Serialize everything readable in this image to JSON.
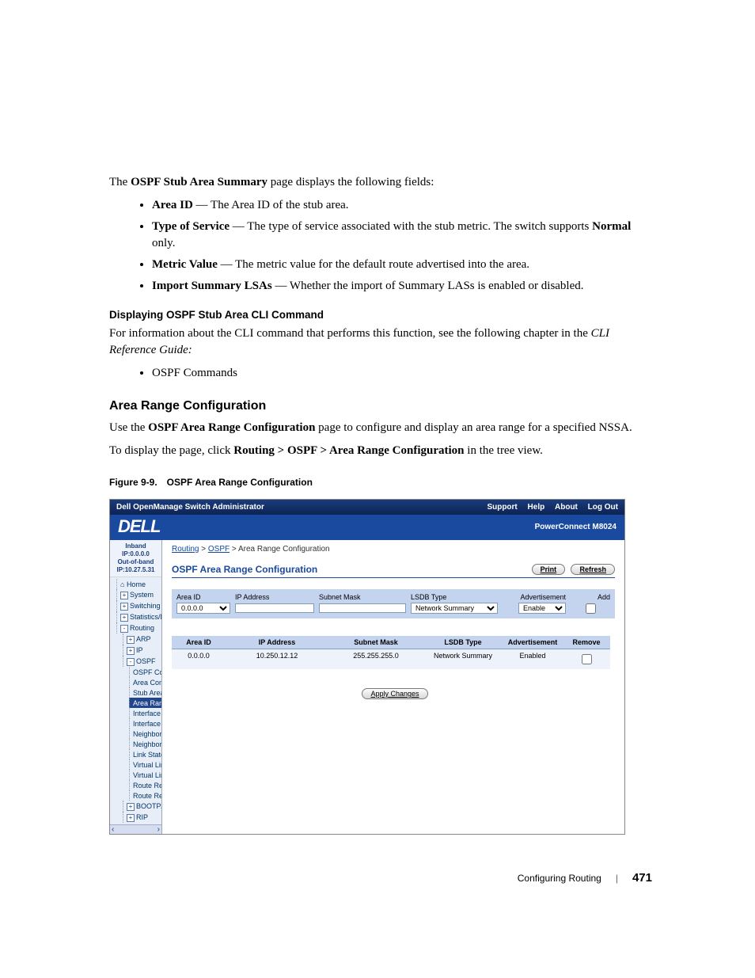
{
  "intro": {
    "lead_pre": "The ",
    "lead_bold": "OSPF Stub Area Summary",
    "lead_post": " page displays the following fields:"
  },
  "fields": [
    {
      "term": "Area ID",
      "desc": "The Area ID of the stub area."
    },
    {
      "term": "Type of Service",
      "desc_pre": "The type of service associated with the stub metric. The switch supports ",
      "desc_bold": "Normal",
      "desc_post": " only."
    },
    {
      "term": "Metric Value",
      "desc": "The metric value for the default route advertised into the area."
    },
    {
      "term": "Import Summary LSAs",
      "desc": "Whether the import of Summary LASs is enabled or disabled."
    }
  ],
  "cli": {
    "heading": "Displaying OSPF Stub Area CLI Command",
    "body": "For information about the CLI command that performs this function, see the following chapter in the ",
    "ref": "CLI Reference Guide:",
    "item": "OSPF Commands"
  },
  "section_heading": "Area Range Configuration",
  "section_body": {
    "pre": "Use the ",
    "bold": "OSPF Area Range Configuration",
    "post": " page to configure and display an area range for a specified NSSA."
  },
  "nav_sentence": {
    "pre": "To display the page, click ",
    "bold": "Routing > OSPF > Area Range Configuration",
    "post": " in the tree view."
  },
  "figure_caption": "Figure 9-9. OSPF Area Range Configuration",
  "shot": {
    "titlebar": "Dell OpenManage Switch Administrator",
    "nav": {
      "support": "Support",
      "help": "Help",
      "about": "About",
      "logout": "Log Out"
    },
    "brand": "DELL",
    "product": "PowerConnect M8024",
    "sidebar": {
      "ip1": "Inband IP:0.0.0.0",
      "ip2": "Out-of-band IP:10.27.5.31",
      "nodes": [
        {
          "lvl": 1,
          "exp": "",
          "label": "Home",
          "icon": "home"
        },
        {
          "lvl": 1,
          "exp": "+",
          "label": "System"
        },
        {
          "lvl": 1,
          "exp": "+",
          "label": "Switching"
        },
        {
          "lvl": 1,
          "exp": "+",
          "label": "Statistics/RMON"
        },
        {
          "lvl": 1,
          "exp": "-",
          "label": "Routing"
        },
        {
          "lvl": 2,
          "exp": "+",
          "label": "ARP"
        },
        {
          "lvl": 2,
          "exp": "+",
          "label": "IP"
        },
        {
          "lvl": 2,
          "exp": "-",
          "label": "OSPF"
        },
        {
          "lvl": 3,
          "exp": "",
          "label": "OSPF Configuratio"
        },
        {
          "lvl": 3,
          "exp": "",
          "label": "Area Configuration"
        },
        {
          "lvl": 3,
          "exp": "",
          "label": "Stub Area Summa"
        },
        {
          "lvl": 3,
          "exp": "",
          "label": "Area Range Con",
          "selected": true
        },
        {
          "lvl": 3,
          "exp": "",
          "label": "Interface Statistics"
        },
        {
          "lvl": 3,
          "exp": "",
          "label": "Interface Configura"
        },
        {
          "lvl": 3,
          "exp": "",
          "label": "Neighbor Table"
        },
        {
          "lvl": 3,
          "exp": "",
          "label": "Neighbor Configura"
        },
        {
          "lvl": 3,
          "exp": "",
          "label": "Link State Databa"
        },
        {
          "lvl": 3,
          "exp": "",
          "label": "Virtual Link Config"
        },
        {
          "lvl": 3,
          "exp": "",
          "label": "Virtual Link Summ"
        },
        {
          "lvl": 3,
          "exp": "",
          "label": "Route Redistributio"
        },
        {
          "lvl": 3,
          "exp": "",
          "label": "Route Redistributio"
        },
        {
          "lvl": 2,
          "exp": "+",
          "label": "BOOTP/DHCP Relay"
        },
        {
          "lvl": 2,
          "exp": "+",
          "label": "RIP"
        }
      ]
    },
    "crumb": {
      "a1": "Routing",
      "a2": "OSPF",
      "tail": " > Area Range Configuration"
    },
    "panel_title": "OSPF Area Range Configuration",
    "buttons": {
      "print": "Print",
      "refresh": "Refresh",
      "apply": "Apply Changes"
    },
    "form": {
      "headers": {
        "area": "Area ID",
        "ip": "IP Address",
        "mask": "Subnet Mask",
        "lsdb": "LSDB Type",
        "adv": "Advertisement",
        "add": "Add"
      },
      "area_options": [
        "0.0.0.0"
      ],
      "lsdb_options": [
        "Network Summary"
      ],
      "adv_options": [
        "Enable"
      ]
    },
    "table": {
      "headers": {
        "area": "Area ID",
        "ip": "IP Address",
        "mask": "Subnet Mask",
        "lsdb": "LSDB Type",
        "adv": "Advertisement",
        "remove": "Remove"
      },
      "row": {
        "area": "0.0.0.0",
        "ip": "10.250.12.12",
        "mask": "255.255.255.0",
        "lsdb": "Network Summary",
        "adv": "Enabled"
      }
    }
  },
  "footer": {
    "section": "Configuring Routing",
    "page": "471"
  }
}
